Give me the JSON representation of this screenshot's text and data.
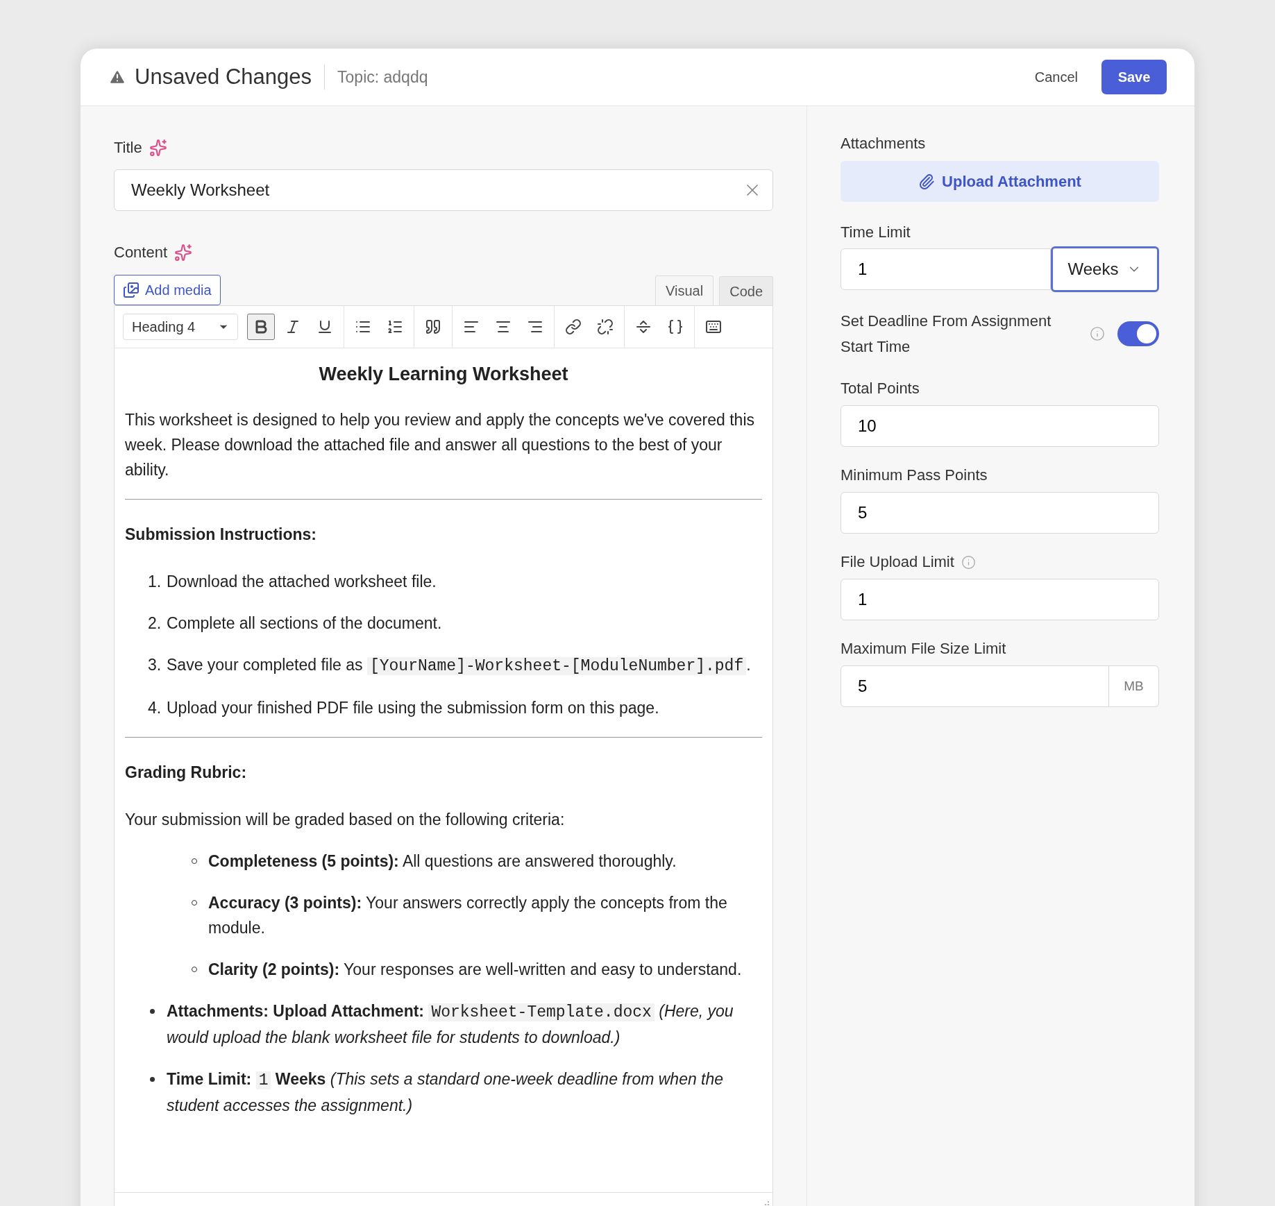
{
  "header": {
    "title": "Unsaved Changes",
    "topic": "Topic: adqdq",
    "cancel": "Cancel",
    "save": "Save"
  },
  "title_field": {
    "label": "Title",
    "value": "Weekly Worksheet"
  },
  "content": {
    "label": "Content",
    "add_media": "Add media",
    "tabs": [
      {
        "label": "Visual",
        "selected": true
      },
      {
        "label": "Code",
        "selected": false
      }
    ],
    "format_select": "Heading 4",
    "toolbar_groups": [
      [
        {
          "kind": "bold",
          "active": true
        },
        {
          "kind": "italic",
          "active": false
        },
        {
          "kind": "underline",
          "active": false
        }
      ],
      [
        {
          "kind": "bullets",
          "active": false
        },
        {
          "kind": "numbers",
          "active": false
        }
      ],
      [
        {
          "kind": "quote",
          "active": false
        }
      ],
      [
        {
          "kind": "align-left",
          "active": false
        },
        {
          "kind": "align-center",
          "active": false
        },
        {
          "kind": "align-right",
          "active": false
        }
      ],
      [
        {
          "kind": "link",
          "active": false
        },
        {
          "kind": "unlink",
          "active": false
        }
      ],
      [
        {
          "kind": "more",
          "active": false
        },
        {
          "kind": "code",
          "active": false
        }
      ],
      [
        {
          "kind": "keyboard",
          "active": false
        }
      ]
    ],
    "document": [
      {
        "kind": "heading",
        "text": "Weekly Learning Worksheet"
      },
      {
        "kind": "paragraph",
        "parts": [
          {
            "kind": "plain",
            "text": "This worksheet is designed to help you review and apply the concepts we've covered this week. Please download the attached file and answer all questions to the best of your ability."
          }
        ]
      },
      {
        "kind": "rule"
      },
      {
        "kind": "subheading",
        "text": "Submission Instructions:"
      },
      {
        "kind": "ordered",
        "items": [
          {
            "marker": "1.",
            "parts": [
              {
                "kind": "plain",
                "text": "Download the attached worksheet file."
              }
            ]
          },
          {
            "marker": "2.",
            "parts": [
              {
                "kind": "plain",
                "text": "Complete all sections of the document."
              }
            ]
          },
          {
            "marker": "3.",
            "parts": [
              {
                "kind": "plain",
                "text": "Save your completed file as "
              },
              {
                "kind": "code",
                "text": "[YourName]-Worksheet-[ModuleNumber].pdf"
              },
              {
                "kind": "plain",
                "text": "."
              }
            ]
          },
          {
            "marker": "4.",
            "parts": [
              {
                "kind": "plain",
                "text": "Upload your finished PDF file using the submission form on this page."
              }
            ]
          }
        ]
      },
      {
        "kind": "rule"
      },
      {
        "kind": "subheading",
        "text": "Grading Rubric:"
      },
      {
        "kind": "paragraph",
        "parts": [
          {
            "kind": "plain",
            "text": "Your submission will be graded based on the following criteria:"
          }
        ]
      },
      {
        "kind": "circle_list",
        "items": [
          {
            "parts": [
              {
                "kind": "bold",
                "text": "Completeness (5 points):"
              },
              {
                "kind": "plain",
                "text": " All questions are answered thoroughly."
              }
            ]
          },
          {
            "parts": [
              {
                "kind": "bold",
                "text": "Accuracy (3 points):"
              },
              {
                "kind": "plain",
                "text": " Your answers correctly apply the concepts from the module."
              }
            ]
          },
          {
            "parts": [
              {
                "kind": "bold",
                "text": "Clarity (2 points):"
              },
              {
                "kind": "plain",
                "text": " Your responses are well-written and easy to understand."
              }
            ]
          }
        ]
      },
      {
        "kind": "bullet_list",
        "items": [
          {
            "parts": [
              {
                "kind": "bold",
                "text": "Attachments: Upload Attachment: "
              },
              {
                "kind": "code",
                "text": "Worksheet-Template.docx"
              },
              {
                "kind": "italic",
                "text": " (Here, you would upload the blank worksheet file for students to download.)"
              }
            ]
          },
          {
            "parts": [
              {
                "kind": "bold",
                "text": "Time Limit: "
              },
              {
                "kind": "code",
                "text": "1"
              },
              {
                "kind": "bold",
                "text": " Weeks"
              },
              {
                "kind": "italic",
                "text": " (This sets a standard one-week deadline from when the student accesses the assignment.)"
              }
            ]
          }
        ]
      }
    ]
  },
  "settings": {
    "attachments": {
      "label": "Attachments",
      "button": "Upload Attachment"
    },
    "time_limit": {
      "label": "Time Limit",
      "value": "1",
      "unit": "Weeks",
      "unit_focused": true
    },
    "deadline_toggle": {
      "label": "Set Deadline From Assignment Start Time",
      "on": true
    },
    "fields": [
      {
        "label": "Total Points",
        "value": "10",
        "info": false
      },
      {
        "label": "Minimum Pass Points",
        "value": "5",
        "info": false
      },
      {
        "label": "File Upload Limit",
        "value": "1",
        "info": true
      },
      {
        "label": "Maximum File Size Limit",
        "value": "5",
        "info": false,
        "suffix": "MB"
      }
    ]
  }
}
